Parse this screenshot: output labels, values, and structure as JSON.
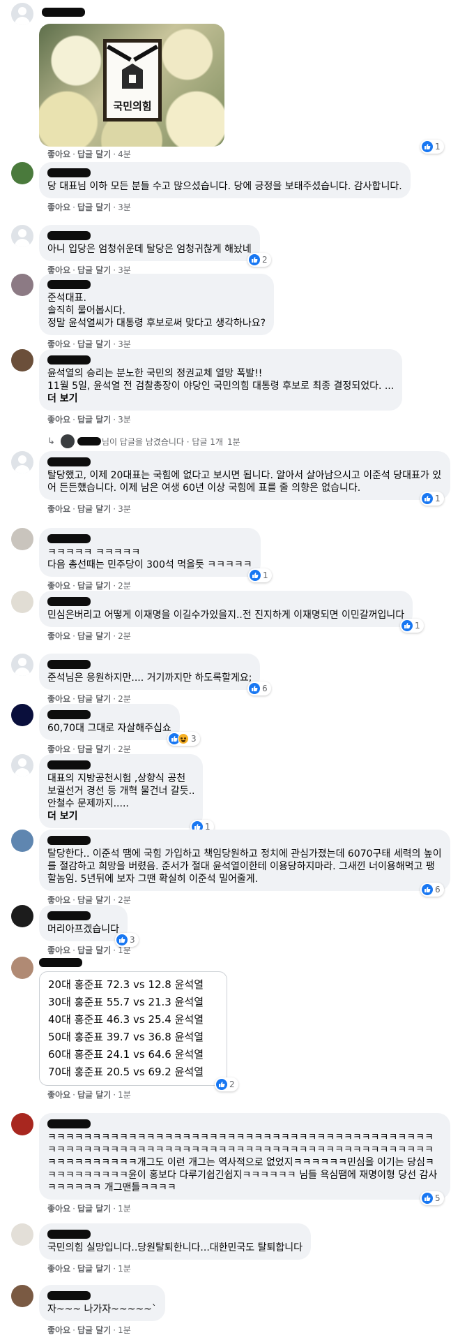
{
  "actions": {
    "like": "좋아요",
    "reply": "답글 달기",
    "sep": "·",
    "more": "더 보기"
  },
  "image_comment": {
    "logo_text": "국민의힘",
    "time": "4분",
    "like_count": "1"
  },
  "comments": [
    {
      "id": 1,
      "text": "당 대표님 이하 모든 분들 수고 많으셨습니다. 당에 긍정을 보태주셨습니다. 감사합니다.",
      "time": "3분"
    },
    {
      "id": 2,
      "text": "아니 입당은 엄청쉬운데 탈당은 엄청귀찮게 해놨네",
      "time": "3분",
      "likes": "2"
    },
    {
      "id": 3,
      "text": "준석대표.\n솔직히 물어봅시다.\n정말 윤석열씨가 대통령 후보로써 맞다고 생각하나요?",
      "time": "3분"
    },
    {
      "id": 4,
      "text": "윤석열의 승리는 분노한 국민의 정권교체 열망 폭발!!\n11월 5일, 윤석열 전 검찰총장이 야당인 국민의힘 대통령 후보로 최종 결정되었다. ...",
      "more": "더 보기",
      "time": "3분"
    },
    {
      "id": 5,
      "text": "탈당했고, 이제 20대표는 국힘에 없다고 보시면 됩니다. 알아서 살아남으시고 이준석 당대표가 있어 든든했습니다. 이제 남은 여생 60년 이상 국힘에 표를 줄 의향은 없습니다.",
      "time": "3분",
      "likes": "1"
    },
    {
      "id": 6,
      "text": "ㅋㅋㅋㅋㅋ ㅋㅋㅋㅋㅋ\n다음 총선때는 민주당이 300석 먹을듯 ㅋㅋㅋㅋㅋ",
      "time": "2분",
      "likes": "1"
    },
    {
      "id": 7,
      "text": "민심은버리고 어떻게 이재명을 이길수가있을지..전 진지하게 이재명되면 이민갈꺼입니다",
      "time": "2분",
      "likes": "1"
    },
    {
      "id": 8,
      "text": "준석님은 응원하지만.... 거기까지만 하도록할게요;",
      "time": "2분",
      "likes": "6"
    },
    {
      "id": 9,
      "text": "60,70대 그대로 자살해주십쇼",
      "time": "2분",
      "likes": "3"
    },
    {
      "id": 10,
      "text": "대표의 지방공천시험 ,상향식 공천\n보궐선거 경선 등 개혁 물건너 갈듯..\n안철수 문제까지.....",
      "more": "더 보기",
      "time": "2분",
      "likes": "1"
    },
    {
      "id": 11,
      "text": "탈당한다.. 이준석 땜에 국힘 가입하고 책임당원하고 정치에 관심가졌는데 6070구태 세력의 높이를 절감하고 희망을 버렸음. 준서가 절대 윤석열이한테 이용당하지마라. 그새낀 너이용해먹고 팽할놈임. 5년뒤에 보자 그땐 확실히 이준석 밀어줄게.",
      "time": "2분",
      "likes": "6"
    },
    {
      "id": 12,
      "text": "머리아프겠습니다",
      "time": "1분",
      "likes": "3"
    },
    {
      "id": 13,
      "poll": [
        "20대 홍준표 72.3 vs 12.8 윤석열",
        "30대 홍준표 55.7 vs 21.3 윤석열",
        "40대 홍준표 46.3 vs 25.4 윤석열",
        "50대 홍준표 39.7 vs 36.8 윤석열",
        "60대 홍준표 24.1 vs 64.6 윤석열",
        "70대 홍준표 20.5 vs 69.2 윤석열"
      ],
      "time": "1분",
      "likes": "2"
    },
    {
      "id": 14,
      "text": "ㅋㅋㅋㅋㅋㅋㅋㅋㅋㅋㅋㅋㅋㅋㅋㅋㅋㅋㅋㅋㅋㅋㅋㅋㅋㅋㅋㅋㅋㅋㅋㅋㅋㅋㅋㅋㅋㅋㅋㅋㅋㅋㅋㅋㅋㅋㅋㅋㅋㅋㅋㅋㅋㅋㅋㅋㅋㅋㅋㅋㅋㅋㅋㅋㅋㅋㅋㅋㅋㅋㅋㅋㅋㅋㅋㅋㅋㅋㅋㅋㅋㅋㅋㅋㅋㅋㅋㅋㅋㅋㅋㅋㅋㅋㅋㅋ개그도 이런 개그는 역사적으로 없었지ㅋㅋㅋㅋㅋㅋ민심을 이기는 당심ㅋㅋㅋㅋㅋㅋㅋㅋㅋㅋ윤이 홍보다 다루기쉽긴쉽지ㅋㅋㅋㅋㅋㅋ 님들 욕심땜에 재명이형 당선 감사ㅋㅋㅋㅋㅋㅋ 개그맨들ㅋㅋㅋㅋ",
      "time": "1분",
      "likes": "5"
    },
    {
      "id": 15,
      "text": "국민의힘 실망입니다..당원탈퇴한니다...대한민국도 탈퇴합니다",
      "time": "1분"
    },
    {
      "id": 16,
      "text": "자~~~ 나가자~~~~~`",
      "time": "1분"
    }
  ],
  "reply_summary": {
    "text": "님이 답글을 남겼습니다 · 답글 1개",
    "time": "1분"
  },
  "colors": {
    "bubble": "#f0f2f5",
    "like_blue": "#1877f2",
    "meta": "#65676b"
  }
}
